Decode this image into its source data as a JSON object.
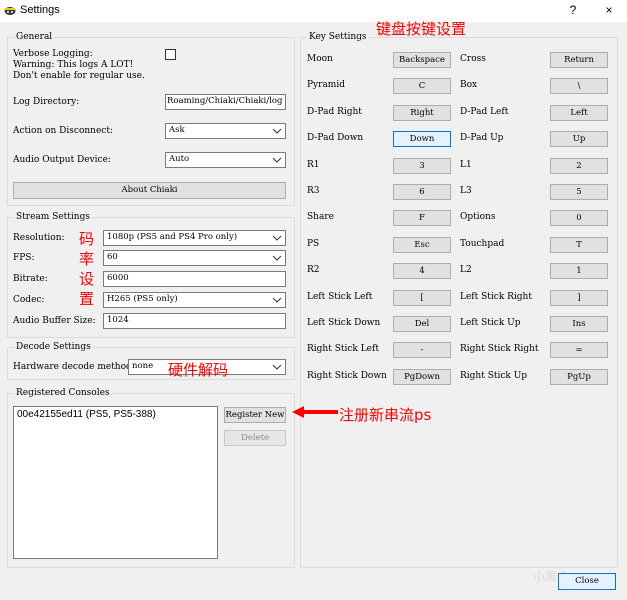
{
  "window": {
    "title": "Settings",
    "help": "?",
    "close": "×"
  },
  "general": {
    "legend": "General",
    "verbose_label": "Verbose Logging:\nWarning: This logs A LOT!\nDon't enable for regular use.",
    "log_dir_label": "Log Directory:",
    "log_dir_value": "Roaming/Chiaki/Chiaki/log",
    "disconnect_label": "Action on Disconnect:",
    "disconnect_value": "Ask",
    "audio_out_label": "Audio Output Device:",
    "audio_out_value": "Auto",
    "about_button": "About Chiaki"
  },
  "stream": {
    "legend": "Stream Settings",
    "resolution_label": "Resolution:",
    "resolution_value": "1080p (PS5 and PS4 Pro only)",
    "fps_label": "FPS:",
    "fps_value": "60",
    "bitrate_label": "Bitrate:",
    "bitrate_value": "6000",
    "codec_label": "Codec:",
    "codec_value": "H265 (PS5 only)",
    "buffer_label": "Audio Buffer Size:",
    "buffer_value": "1024"
  },
  "decode": {
    "legend": "Decode Settings",
    "method_label": "Hardware decode method:",
    "method_value": "none"
  },
  "consoles": {
    "legend": "Registered Consoles",
    "items": [
      "00e42155ed11 (PS5, PS5-388)"
    ],
    "register_button": "Register New",
    "delete_button": "Delete"
  },
  "keys": {
    "legend": "Key Settings",
    "rows": [
      {
        "l1": "Moon",
        "k1": "Backspace",
        "l2": "Cross",
        "k2": "Return"
      },
      {
        "l1": "Pyramid",
        "k1": "C",
        "l2": "Box",
        "k2": "\\"
      },
      {
        "l1": "D-Pad Right",
        "k1": "Right",
        "l2": "D-Pad Left",
        "k2": "Left"
      },
      {
        "l1": "D-Pad Down",
        "k1": "Down",
        "l2": "D-Pad Up",
        "k2": "Up"
      },
      {
        "l1": "R1",
        "k1": "3",
        "l2": "L1",
        "k2": "2"
      },
      {
        "l1": "R3",
        "k1": "6",
        "l2": "L3",
        "k2": "5"
      },
      {
        "l1": "Share",
        "k1": "F",
        "l2": "Options",
        "k2": "0"
      },
      {
        "l1": "PS",
        "k1": "Esc",
        "l2": "Touchpad",
        "k2": "T"
      },
      {
        "l1": "R2",
        "k1": "4",
        "l2": "L2",
        "k2": "1"
      },
      {
        "l1": "Left Stick Left",
        "k1": "[",
        "l2": "Left Stick Right",
        "k2": "]"
      },
      {
        "l1": "Left Stick Down",
        "k1": "Del",
        "l2": "Left Stick Up",
        "k2": "Ins"
      },
      {
        "l1": "Right Stick Left",
        "k1": "-",
        "l2": "Right Stick Right",
        "k2": "="
      },
      {
        "l1": "Right Stick Down",
        "k1": "PgDown",
        "l2": "Right Stick Up",
        "k2": "PgUp"
      }
    ]
  },
  "annotations": {
    "key_settings": "键盘按键设置",
    "bitrate": [
      "码",
      "率",
      "设",
      "置"
    ],
    "hw_decode": "硬件解码",
    "register": "注册新串流ps"
  },
  "watermark": "小黑盒",
  "footer": {
    "close_button": "Close"
  },
  "colors": {
    "annotation": "#ff0000",
    "focus_border": "#0078d7"
  }
}
